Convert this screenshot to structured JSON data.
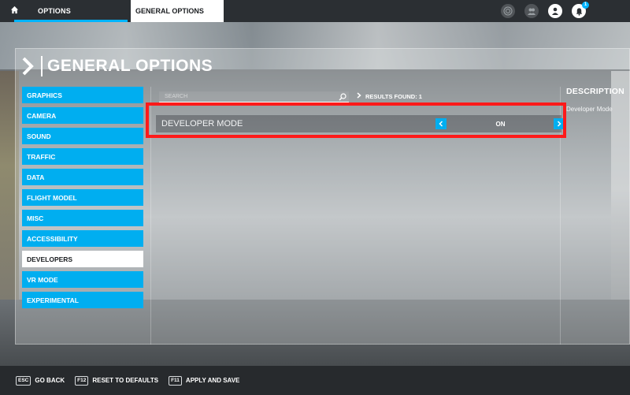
{
  "topbar": {
    "home_icon": "home-icon",
    "options_tab": "OPTIONS",
    "general_tab": "GENERAL OPTIONS",
    "icons": [
      "radar-icon",
      "friends-icon",
      "profile-icon",
      "notifications-icon"
    ],
    "notification_count": "1"
  },
  "panel": {
    "title": "GENERAL OPTIONS"
  },
  "sidebar": {
    "items": [
      {
        "label": "GRAPHICS"
      },
      {
        "label": "CAMERA"
      },
      {
        "label": "SOUND"
      },
      {
        "label": "TRAFFIC"
      },
      {
        "label": "DATA"
      },
      {
        "label": "FLIGHT MODEL"
      },
      {
        "label": "MISC"
      },
      {
        "label": "ACCESSIBILITY"
      },
      {
        "label": "DEVELOPERS"
      },
      {
        "label": "VR MODE"
      },
      {
        "label": "EXPERIMENTAL"
      }
    ],
    "active": "DEVELOPERS"
  },
  "search": {
    "placeholder": "SEARCH",
    "results_label": "RESULTS FOUND: 1"
  },
  "option": {
    "label": "DEVELOPER MODE",
    "value": "ON"
  },
  "description": {
    "title": "DESCRIPTION",
    "text": "Developer Mode"
  },
  "bottombar": {
    "back_key": "ESC",
    "back_label": "GO BACK",
    "reset_key": "F12",
    "reset_label": "RESET TO DEFAULTS",
    "apply_key": "F11",
    "apply_label": "APPLY AND SAVE"
  },
  "colors": {
    "accent": "#00aef0",
    "highlight": "#ff1a1a",
    "active_item_bg": "#ffffff"
  }
}
